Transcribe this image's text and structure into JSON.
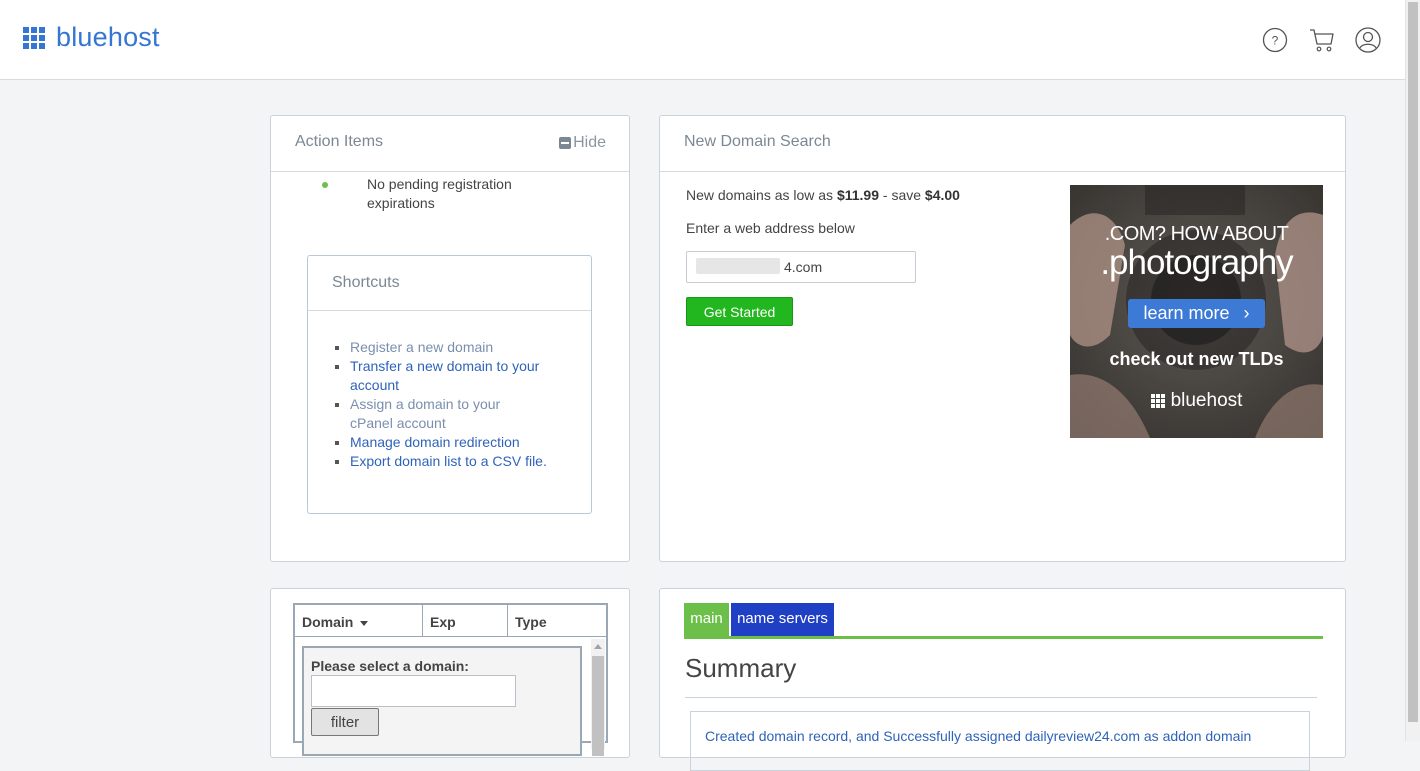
{
  "header": {
    "brand": "bluehost",
    "icons": [
      "help-icon",
      "cart-icon",
      "account-icon"
    ]
  },
  "action_items": {
    "title": "Action Items",
    "hide_label": "Hide",
    "status_line1": "No pending registration",
    "status_line2": "expirations"
  },
  "shortcuts": {
    "title": "Shortcuts",
    "items": [
      {
        "line1": "Register a new domain",
        "line2": ""
      },
      {
        "line1": "Transfer a new domain to your",
        "line2": "account"
      },
      {
        "line1": "Assign a domain to your",
        "line2": "cPanel account"
      },
      {
        "line1": "Manage domain redirection",
        "line2": ""
      },
      {
        "line1": "Export domain list to a CSV file.",
        "line2": ""
      }
    ]
  },
  "domain_search": {
    "title": "New Domain Search",
    "promo_prefix": "New domains as low as ",
    "promo_price": "$11.99",
    "promo_mid": " - save ",
    "promo_save": "$4.00",
    "instruction": "Enter a web address below",
    "input_value": "4.com",
    "button_label": "Get Started"
  },
  "ad": {
    "line1": ".COM? HOW ABOUT",
    "line2": ".photography",
    "button_label": "learn more",
    "line3": "check out new TLDs",
    "brand": "bluehost"
  },
  "domain_table": {
    "columns": [
      "Domain",
      "Exp",
      "Type"
    ],
    "select_label": "Please select a domain:",
    "filter_label": "filter"
  },
  "summary": {
    "tabs": [
      "main",
      "name servers"
    ],
    "title": "Summary",
    "message": "Created domain record, and Successfully assigned dailyreview24.com as addon domain"
  },
  "colors": {
    "brand_blue": "#3575d3",
    "green": "#22b61f",
    "tab_green": "#6cc04a",
    "tab_blue": "#1f3fc4",
    "link": "#2f63b8"
  }
}
